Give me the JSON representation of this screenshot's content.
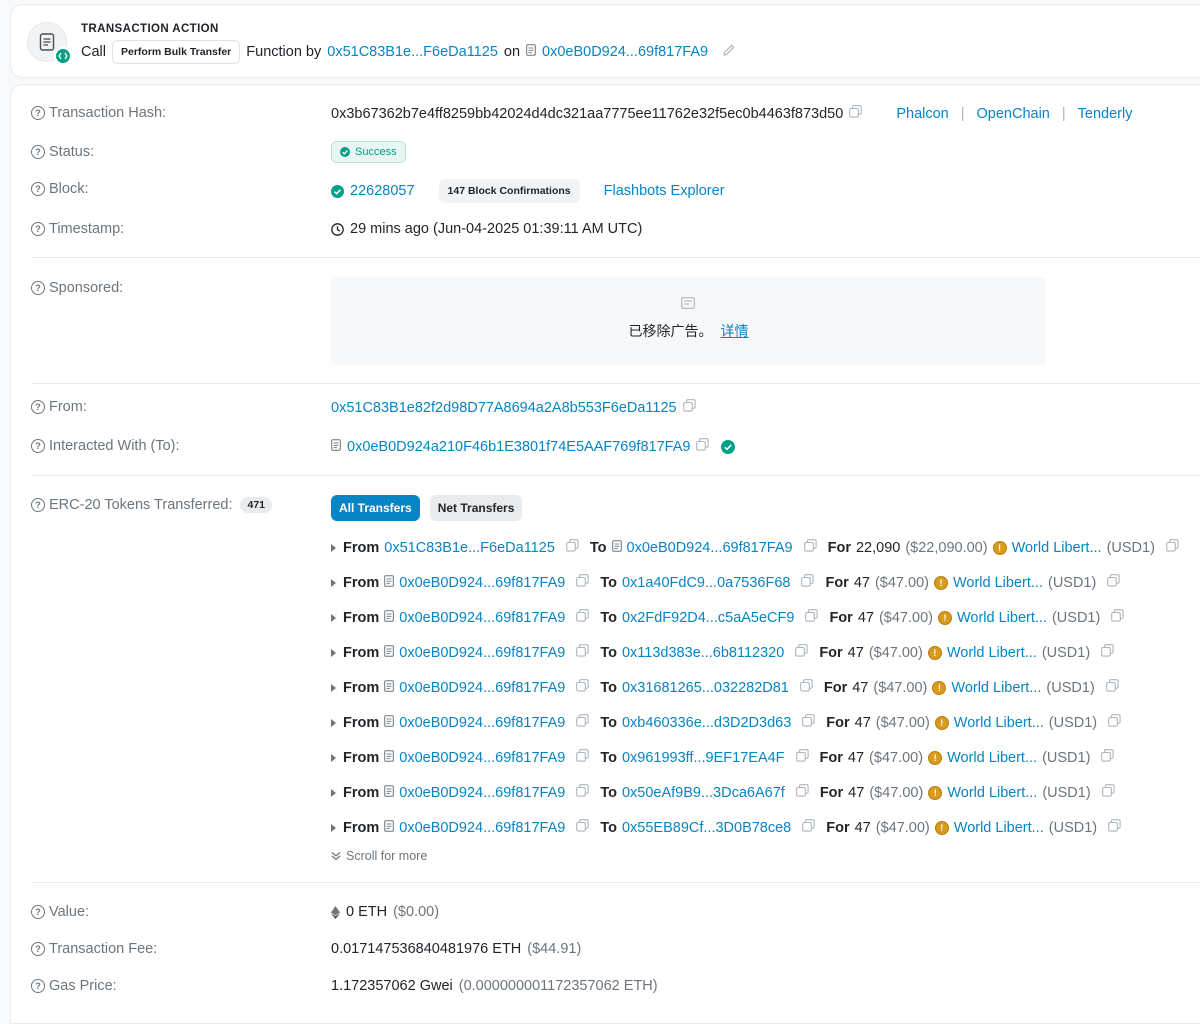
{
  "action": {
    "heading": "TRANSACTION ACTION",
    "call_word": "Call",
    "function_name": "Perform Bulk Transfer",
    "function_by": "Function by",
    "caller": "0x51C83B1e...F6eDa1125",
    "on_word": "on",
    "contract": "0x0eB0D924...69f817FA9"
  },
  "details": {
    "tx_hash_label": "Transaction Hash:",
    "tx_hash": "0x3b67362b7e4ff8259bb42024d4dc321aa7775ee11762e32f5ec0b4463f873d50",
    "tools": [
      "Phalcon",
      "OpenChain",
      "Tenderly"
    ],
    "status_label": "Status:",
    "status": "Success",
    "block_label": "Block:",
    "block": "22628057",
    "confirmations": "147 Block Confirmations",
    "flashbots": "Flashbots Explorer",
    "timestamp_label": "Timestamp:",
    "timestamp": "29 mins ago (Jun-04-2025 01:39:11 AM UTC)",
    "sponsored_label": "Sponsored:",
    "ad_text": "已移除广告。",
    "ad_link": "详情",
    "from_label": "From:",
    "from": "0x51C83B1e82f2d98D77A8694a2A8b553F6eDa1125",
    "to_label": "Interacted With (To):",
    "to": "0x0eB0D924a210F46b1E3801f74E5AAF769f817FA9",
    "erc20_label": "ERC-20 Tokens Transferred:",
    "erc20_count": "471",
    "tabs": [
      "All Transfers",
      "Net Transfers"
    ],
    "scroll_more": "Scroll for more",
    "value_label": "Value:",
    "value": "0 ETH",
    "value_usd": "($0.00)",
    "fee_label": "Transaction Fee:",
    "fee": "0.017147536840481976 ETH",
    "fee_usd": "($44.91)",
    "gas_label": "Gas Price:",
    "gas": "1.172357062 Gwei",
    "gas_eth": "(0.000000001172357062 ETH)"
  },
  "transfers": [
    {
      "from_word": "From",
      "from": "0x51C83B1e...F6eDa1125",
      "to_word": "To",
      "to": "0x0eB0D924...69f817FA9",
      "for_word": "For",
      "amount": "22,090",
      "usd": "($22,090.00)",
      "token": "World Libert...",
      "symbol": "(USD1)"
    },
    {
      "from_word": "From",
      "from": "0x0eB0D924...69f817FA9",
      "to_word": "To",
      "to": "0x1a40FdC9...0a7536F68",
      "for_word": "For",
      "amount": "47",
      "usd": "($47.00)",
      "token": "World Libert...",
      "symbol": "(USD1)"
    },
    {
      "from_word": "From",
      "from": "0x0eB0D924...69f817FA9",
      "to_word": "To",
      "to": "0x2FdF92D4...c5aA5eCF9",
      "for_word": "For",
      "amount": "47",
      "usd": "($47.00)",
      "token": "World Libert...",
      "symbol": "(USD1)"
    },
    {
      "from_word": "From",
      "from": "0x0eB0D924...69f817FA9",
      "to_word": "To",
      "to": "0x113d383e...6b8112320",
      "for_word": "For",
      "amount": "47",
      "usd": "($47.00)",
      "token": "World Libert...",
      "symbol": "(USD1)"
    },
    {
      "from_word": "From",
      "from": "0x0eB0D924...69f817FA9",
      "to_word": "To",
      "to": "0x31681265...032282D81",
      "for_word": "For",
      "amount": "47",
      "usd": "($47.00)",
      "token": "World Libert...",
      "symbol": "(USD1)"
    },
    {
      "from_word": "From",
      "from": "0x0eB0D924...69f817FA9",
      "to_word": "To",
      "to": "0xb460336e...d3D2D3d63",
      "for_word": "For",
      "amount": "47",
      "usd": "($47.00)",
      "token": "World Libert...",
      "symbol": "(USD1)"
    },
    {
      "from_word": "From",
      "from": "0x0eB0D924...69f817FA9",
      "to_word": "To",
      "to": "0x961993ff...9EF17EA4F",
      "for_word": "For",
      "amount": "47",
      "usd": "($47.00)",
      "token": "World Libert...",
      "symbol": "(USD1)"
    },
    {
      "from_word": "From",
      "from": "0x0eB0D924...69f817FA9",
      "to_word": "To",
      "to": "0x50eAf9B9...3Dca6A67f",
      "for_word": "For",
      "amount": "47",
      "usd": "($47.00)",
      "token": "World Libert...",
      "symbol": "(USD1)"
    },
    {
      "from_word": "From",
      "from": "0x0eB0D924...69f817FA9",
      "to_word": "To",
      "to": "0x55EB89Cf...3D0B78ce8",
      "for_word": "For",
      "amount": "47",
      "usd": "($47.00)",
      "token": "World Libert...",
      "symbol": "(USD1)"
    }
  ]
}
